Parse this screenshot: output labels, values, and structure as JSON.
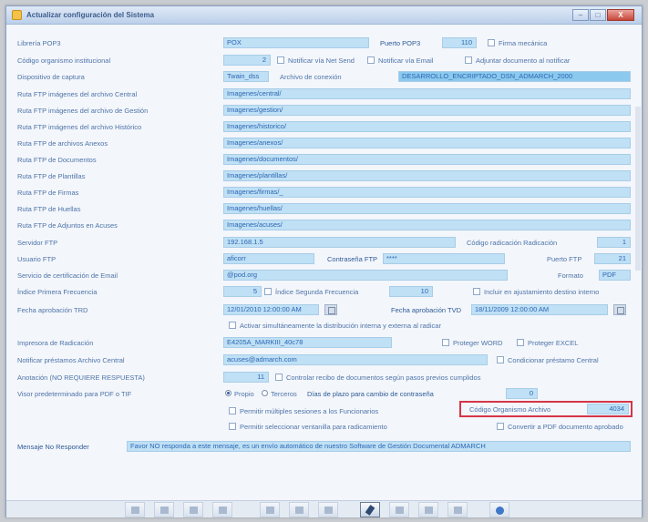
{
  "window": {
    "title": "Actualizar configuración del Sistema",
    "minimize": "–",
    "maximize": "□",
    "close": "X"
  },
  "form": {
    "libreria_pop3": {
      "label": "Librería POP3",
      "value": "POX"
    },
    "puerto_pop3": {
      "label": "Puerto POP3",
      "value": "110"
    },
    "firma_mecanica": {
      "label": "Firma mecánica"
    },
    "codigo_organismo": {
      "label": "Código organismo institucional",
      "value": "2"
    },
    "notificar_net_send": {
      "label": "Notificar vía Net Send"
    },
    "notificar_email": {
      "label": "Notificar vía Email"
    },
    "adjuntar_documento": {
      "label": "Adjuntar documento al notificar"
    },
    "dispositivo_captura": {
      "label": "Dispositivo de captura",
      "value": "Twain_dss"
    },
    "archivo_conexion": {
      "label": "Archivo de conexión",
      "value": "DESARROLLO_ENCRIPTADO_DSN_ADMARCH_2000"
    },
    "paths": [
      {
        "label": "Ruta FTP imágenes del archivo Central",
        "value": "Imagenes/central/"
      },
      {
        "label": "Ruta FTP imágenes del archivo de Gestión",
        "value": "Imagenes/gestion/"
      },
      {
        "label": "Ruta FTP imágenes del archivo Histórico",
        "value": "Imagenes/historico/"
      },
      {
        "label": "Ruta FTP de archivos Anexos",
        "value": "Imagenes/anexos/"
      },
      {
        "label": "Ruta FTP de Documentos",
        "value": "Imagenes/documentos/"
      },
      {
        "label": "Ruta FTP de Plantillas",
        "value": "Imagenes/plantillas/"
      },
      {
        "label": "Ruta FTP de Firmas",
        "value": "Imagenes/firmas/_"
      },
      {
        "label": "Ruta FTP de Huellas",
        "value": "Imagenes/huellas/"
      },
      {
        "label": "Ruta FTP de Adjuntos en Acuses",
        "value": "Imagenes/acuses/"
      }
    ],
    "servidor_ftp": {
      "label": "Servidor FTP",
      "value": "192.168.1.5"
    },
    "codigo_radicacion": {
      "label": "Código radicación Radicación",
      "value": "1"
    },
    "usuario_ftp": {
      "label": "Usuario FTP",
      "value": "aficorr"
    },
    "contrasena_ftp": {
      "label": "Contraseña FTP",
      "value": "****"
    },
    "puerto_ftp": {
      "label": "Puerto FTP",
      "value": "21"
    },
    "servicio_certificacion": {
      "label": "Servicio de certificación de Email",
      "value": "@pod.org"
    },
    "formato": {
      "label": "Formato",
      "value": "PDF"
    },
    "indice_primera": {
      "label": "Índice Primera Frecuencia",
      "value": "5"
    },
    "indice_segunda": {
      "label": "Índice Segunda Frecuencia",
      "value": "10"
    },
    "incluir_ajustamiento": {
      "label": "Incluir en ajustamiento destino interno"
    },
    "fecha_aprobacion_trd": {
      "label": "Fecha aprobación TRD",
      "value": "12/01/2010 12:00:00 AM"
    },
    "fecha_aprobacion_tvd": {
      "label": "Fecha aprobación TVD",
      "value": "18/11/2009 12:00:00 AM"
    },
    "activar_distribucion": {
      "label": "Activar simultáneamente la distribución interna y externa al radicar"
    },
    "impresora_radicacion": {
      "label": "Impresora de Radicación",
      "value": "E4205A_MARKIII_40c78"
    },
    "proteger_word": {
      "label": "Proteger WORD"
    },
    "proteger_excel": {
      "label": "Proteger EXCEL"
    },
    "notificar_prestamos": {
      "label": "Notificar préstamos Archivo Central",
      "value": "acuses@admarch.com"
    },
    "condicionar_prestamo": {
      "label": "Condicionar préstamo Central"
    },
    "anotacion": {
      "label": "Anotación (NO REQUIERE RESPUESTA)",
      "value": "11"
    },
    "controlar_recibo": {
      "label": "Controlar recibo de documentos según pasos previos cumplidos"
    },
    "visor_pdf": {
      "label": "Visor predeterminado para PDF o TIF"
    },
    "radio_propio": {
      "label": "Propio"
    },
    "radio_terceros": {
      "label": "Terceros"
    },
    "dias_plazo": {
      "label": "Días de plazo para cambio de contraseña",
      "value": "0"
    },
    "permitir_sesiones": {
      "label": "Permitir múltiples sesiones a los Funcionarios"
    },
    "codigo_organismo_archivo": {
      "label": "Código Organismo Archivo",
      "value": "4034"
    },
    "permitir_ventanilla": {
      "label": "Permitir seleccionar ventanilla para radicamiento"
    },
    "convertir_pdf": {
      "label": "Convertir a PDF documento aprobado"
    },
    "mensaje_no_responder": {
      "label": "Mensaje No Responder",
      "value": "Favor NO responda a este mensaje, es un envío automático de nuestro Software de Gestión Documental ADMARCH"
    }
  }
}
